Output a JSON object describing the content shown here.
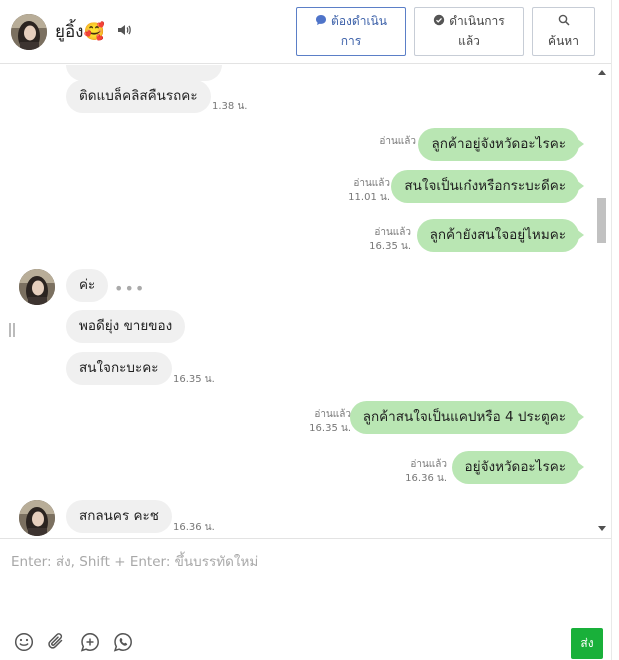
{
  "header": {
    "contact_name": "ยูอิ้ง🥰",
    "btn_todo": {
      "line1": "ต้องดำเนิน",
      "line2": "การ"
    },
    "btn_done": {
      "line1": "ดำเนินการ",
      "line2": "แล้ว"
    },
    "btn_search": {
      "label": "ค้นหา"
    }
  },
  "messages": [
    {
      "dir": "in",
      "text": "ติดแบล็คลิสคืนรถคะ",
      "time": "1.38 น."
    },
    {
      "dir": "out",
      "text": "ลูกค้าอยู่จังหวัดอะไรคะ",
      "read": "อ่านแล้ว"
    },
    {
      "dir": "out",
      "text": "สนใจเป็นเก๋งหรือกระบะดีคะ",
      "read": "อ่านแล้ว",
      "time": "11.01 น."
    },
    {
      "dir": "out",
      "text": "ลูกค้ายังสนใจอยู่ไหมคะ",
      "read": "อ่านแล้ว",
      "time": "16.35 น."
    },
    {
      "dir": "in",
      "text": "ค่ะ"
    },
    {
      "dir": "in",
      "text": "พอดียุ่ง ขายของ"
    },
    {
      "dir": "in",
      "text": "สนใจกะบะคะ",
      "time": "16.35 น."
    },
    {
      "dir": "out",
      "text": "ลูกค้าสนใจเป็นแคปหรือ 4 ประตูคะ",
      "read": "อ่านแล้ว",
      "time": "16.35 น."
    },
    {
      "dir": "out",
      "text": "อยู่จังหวัดอะไรคะ",
      "read": "อ่านแล้ว",
      "time": "16.36 น."
    },
    {
      "dir": "in",
      "text": "สกลนคร คะช",
      "time": "16.36 น."
    }
  ],
  "composer": {
    "placeholder": "Enter: ส่ง, Shift + Enter: ขึ้นบรรทัดใหม่",
    "send_label": "ส่ง"
  },
  "icons": {
    "speaker": "speaker-icon",
    "todo": "chat-bubble-icon",
    "done": "check-circle-icon",
    "search": "search-icon",
    "emoji": "smiley-icon",
    "attach": "paperclip-icon",
    "plus": "plus-circle-icon",
    "whatsapp": "phone-chat-icon"
  },
  "colors": {
    "outgoing_bubble": "#b9e6b3",
    "incoming_bubble": "#f0f0f0",
    "send_button": "#19b03a",
    "todo_accent": "#3a5fa8"
  }
}
